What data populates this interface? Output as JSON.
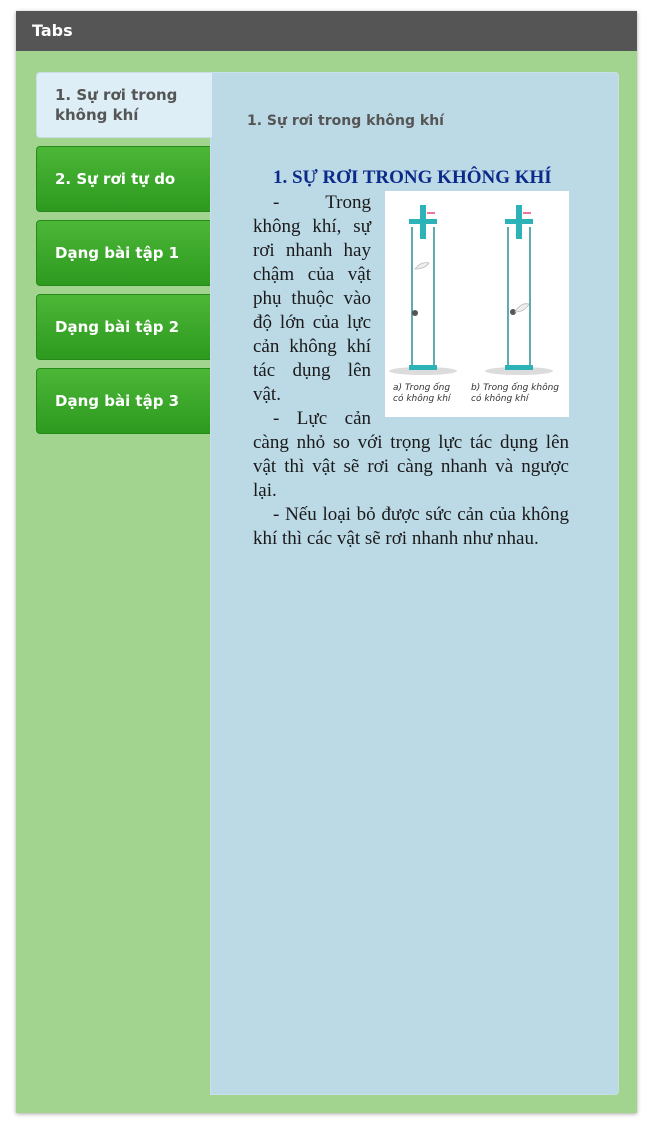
{
  "window": {
    "title": "Tabs"
  },
  "tabs": [
    {
      "label": "1. Sự rơi trong không khí",
      "active": true
    },
    {
      "label": "2. Sự rơi tự do",
      "active": false
    },
    {
      "label": "Dạng bài tập 1",
      "active": false
    },
    {
      "label": "Dạng bài tập 2",
      "active": false
    },
    {
      "label": "Dạng bài tập 3",
      "active": false
    }
  ],
  "panel": {
    "title": "1. Sự rơi trong không khí",
    "heading": "1. SỰ RƠI TRONG KHÔNG KHÍ",
    "paragraphs": [
      "- Trong không khí, sự rơi nhanh hay chậm của vật phụ thuộc vào độ lớn của lực cản không khí tác dụng lên vật.",
      "- Lực cản càng nhỏ so với trọng lực tác dụng lên vật thì vật sẽ rơi càng nhanh và ngược lại.",
      "- Nếu loại bỏ được sức cản của không khí thì các vật sẽ rơi nhanh như nhau."
    ],
    "figure": {
      "caption_a": [
        "a) Trong ống",
        "có không khí"
      ],
      "caption_b": [
        "b) Trong ống không",
        "có không khí"
      ]
    }
  },
  "colors": {
    "background": "#a3d48f",
    "titlebar": "#555555",
    "tab_green": "#3aa82b",
    "panel": "#bcd9e6",
    "heading": "#0c2a8a"
  }
}
